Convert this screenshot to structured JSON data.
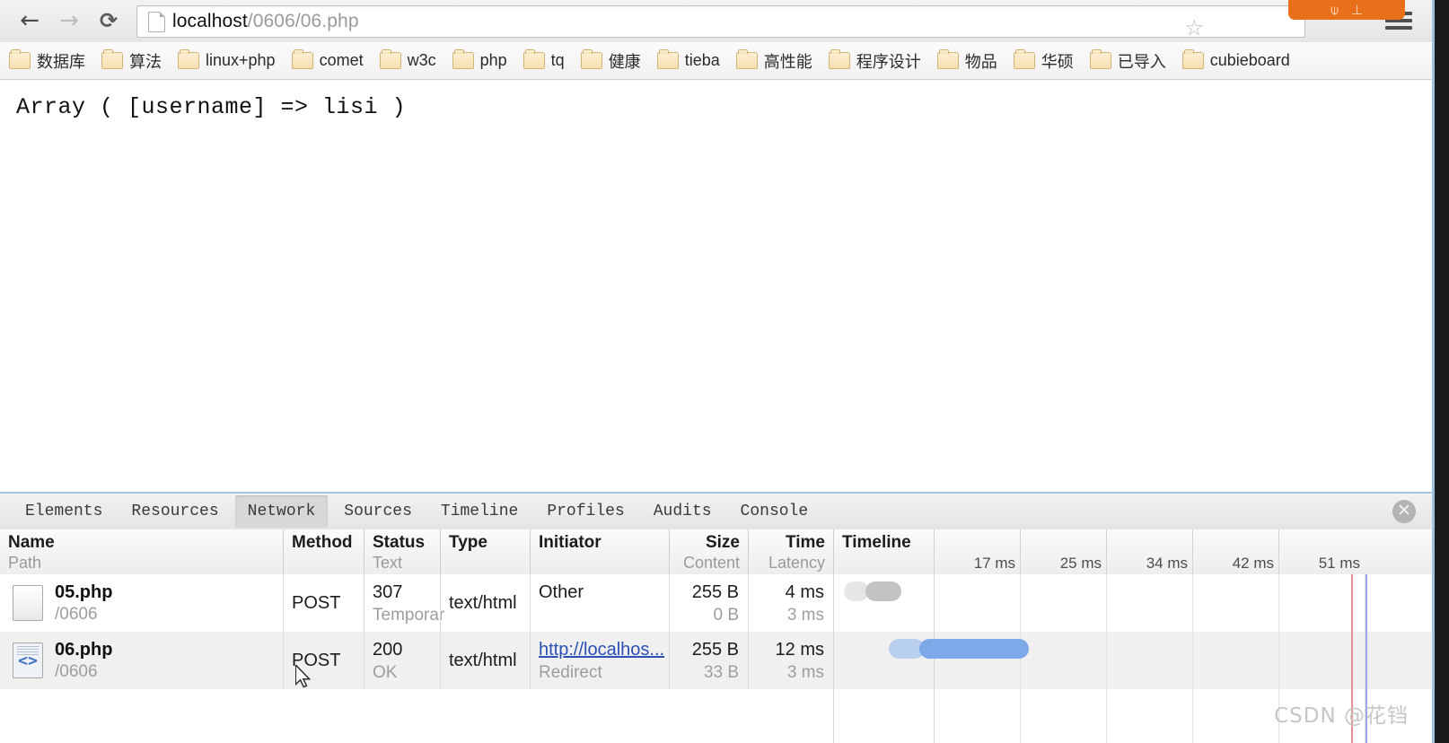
{
  "browser": {
    "nav": {
      "back_label": "←",
      "forward_label": "→",
      "reload_label": "⟳",
      "star_label": "☆"
    },
    "omnibox": {
      "url_host": "localhost",
      "url_path": "/0606/06.php",
      "full_url": "localhost/0606/06.php",
      "page_icon": "document-icon"
    },
    "bookmarks": [
      {
        "label": "数据库"
      },
      {
        "label": "算法"
      },
      {
        "label": "linux+php"
      },
      {
        "label": "comet"
      },
      {
        "label": "w3c"
      },
      {
        "label": "php"
      },
      {
        "label": "tq"
      },
      {
        "label": "健康"
      },
      {
        "label": "tieba"
      },
      {
        "label": "高性能"
      },
      {
        "label": "程序设计"
      },
      {
        "label": "物品"
      },
      {
        "label": "华硕"
      },
      {
        "label": "已导入"
      },
      {
        "label": "cubieboard"
      }
    ],
    "flyout": {
      "icon_left": "⍦",
      "icon_right": "⊥",
      "color": "#e8701a"
    }
  },
  "page": {
    "output": "Array ( [username] => lisi )"
  },
  "devtools": {
    "tabs": [
      {
        "label": "Elements",
        "selected": false
      },
      {
        "label": "Resources",
        "selected": false
      },
      {
        "label": "Network",
        "selected": true
      },
      {
        "label": "Sources",
        "selected": false
      },
      {
        "label": "Timeline",
        "selected": false
      },
      {
        "label": "Profiles",
        "selected": false
      },
      {
        "label": "Audits",
        "selected": false
      },
      {
        "label": "Console",
        "selected": false
      }
    ],
    "close_label": "✕",
    "network": {
      "columns": [
        {
          "primary": "Name",
          "secondary": "Path"
        },
        {
          "primary": "Method",
          "secondary": ""
        },
        {
          "primary": "Status",
          "secondary": "Text"
        },
        {
          "primary": "Type",
          "secondary": ""
        },
        {
          "primary": "Initiator",
          "secondary": ""
        },
        {
          "primary": "Size",
          "secondary": "Content"
        },
        {
          "primary": "Time",
          "secondary": "Latency"
        },
        {
          "primary": "Timeline",
          "secondary": ""
        }
      ],
      "timeline_ticks": [
        "17 ms",
        "25 ms",
        "34 ms",
        "42 ms",
        "51 ms"
      ],
      "rows": [
        {
          "icon": "document-icon",
          "name": "05.php",
          "path": "/0606",
          "method": "POST",
          "status": "307",
          "status_text": "Temporar",
          "type": "text/html",
          "initiator": "Other",
          "initiator_sub": "",
          "size": "255 B",
          "content": "0 B",
          "time": "4 ms",
          "latency": "3 ms"
        },
        {
          "icon": "code-document-icon",
          "name": "06.php",
          "path": "/0606",
          "method": "POST",
          "status": "200",
          "status_text": "OK",
          "type": "text/html",
          "initiator": "http://localhos...",
          "initiator_sub": "Redirect",
          "size": "255 B",
          "content": "33 B",
          "time": "12 ms",
          "latency": "3 ms"
        }
      ]
    }
  },
  "watermark": {
    "text": "CSDN @花铛"
  }
}
